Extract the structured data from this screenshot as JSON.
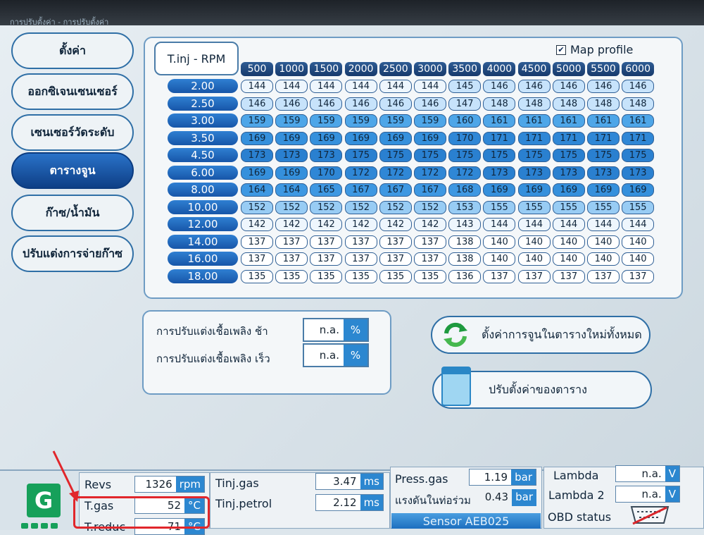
{
  "window": {
    "title": "การปรับตั้งค่า - การปรับตั้งค่า"
  },
  "menu": {
    "items": [
      {
        "label": "ตั้งค่า",
        "active": false
      },
      {
        "label": "ออกซิเจนเซนเซอร์",
        "active": false
      },
      {
        "label": "เซนเซอร์วัดระดับ",
        "active": false
      },
      {
        "label": "ตารางจูน",
        "active": true
      },
      {
        "label": "ก๊าซ/น้ำมัน",
        "active": false
      },
      {
        "label": "ปรับแต่งการจ่ายก๊าซ",
        "active": false
      }
    ]
  },
  "map": {
    "axis_label": "T.inj - RPM",
    "map_profile": {
      "label": "Map profile",
      "checked": true
    },
    "rpm": [
      "500",
      "1000",
      "1500",
      "2000",
      "2500",
      "3000",
      "3500",
      "4000",
      "4500",
      "5000",
      "5500",
      "6000"
    ],
    "tinj": [
      "2.00",
      "2.50",
      "3.00",
      "3.50",
      "4.50",
      "6.00",
      "8.00",
      "10.00",
      "12.00",
      "14.00",
      "16.00",
      "18.00"
    ],
    "rows": [
      [
        "144",
        "144",
        "144",
        "144",
        "144",
        "144",
        "145",
        "146",
        "146",
        "146",
        "146",
        "146"
      ],
      [
        "146",
        "146",
        "146",
        "146",
        "146",
        "146",
        "147",
        "148",
        "148",
        "148",
        "148",
        "148"
      ],
      [
        "159",
        "159",
        "159",
        "159",
        "159",
        "159",
        "160",
        "161",
        "161",
        "161",
        "161",
        "161"
      ],
      [
        "169",
        "169",
        "169",
        "169",
        "169",
        "169",
        "170",
        "171",
        "171",
        "171",
        "171",
        "171"
      ],
      [
        "173",
        "173",
        "173",
        "175",
        "175",
        "175",
        "175",
        "175",
        "175",
        "175",
        "175",
        "175"
      ],
      [
        "169",
        "169",
        "170",
        "172",
        "172",
        "172",
        "172",
        "173",
        "173",
        "173",
        "173",
        "173"
      ],
      [
        "164",
        "164",
        "165",
        "167",
        "167",
        "167",
        "168",
        "169",
        "169",
        "169",
        "169",
        "169"
      ],
      [
        "152",
        "152",
        "152",
        "152",
        "152",
        "152",
        "153",
        "155",
        "155",
        "155",
        "155",
        "155"
      ],
      [
        "142",
        "142",
        "142",
        "142",
        "142",
        "142",
        "143",
        "144",
        "144",
        "144",
        "144",
        "144"
      ],
      [
        "137",
        "137",
        "137",
        "137",
        "137",
        "137",
        "138",
        "140",
        "140",
        "140",
        "140",
        "140"
      ],
      [
        "137",
        "137",
        "137",
        "137",
        "137",
        "137",
        "138",
        "140",
        "140",
        "140",
        "140",
        "140"
      ],
      [
        "135",
        "135",
        "135",
        "135",
        "135",
        "135",
        "136",
        "137",
        "137",
        "137",
        "137",
        "137"
      ]
    ],
    "shades": {
      "135": "#ffffff",
      "136": "#ffffff",
      "137": "#ffffff",
      "138": "#ffffff",
      "140": "#ffffff",
      "142": "#eef6fd",
      "143": "#eef6fd",
      "144": "#eef6fd",
      "145": "#c7e3fb",
      "146": "#c7e3fb",
      "147": "#c7e3fb",
      "148": "#c7e3fb",
      "152": "#98ccf4",
      "153": "#98ccf4",
      "155": "#98ccf4",
      "159": "#4ea6e8",
      "160": "#4ea6e8",
      "161": "#4ea6e8",
      "164": "#3e98e2",
      "165": "#3e98e2",
      "167": "#3e98e2",
      "168": "#3e98e2",
      "169": "#3590dc",
      "170": "#2f87d6",
      "171": "#2f87d6",
      "172": "#2f87d6",
      "173": "#2a80d0",
      "175": "#2a80d0"
    }
  },
  "fuel": {
    "slow_label": "การปรับแต่งเชื้อเพลิง ช้า",
    "fast_label": "การปรับแต่งเชื้อเพลิง เร็ว",
    "slow_value": "n.a.",
    "fast_value": "n.a.",
    "unit": "%"
  },
  "actions": {
    "reset_label": "ตั้งค่าการจูนในตารางใหม่ทั้งหมด",
    "adjust_label": "ปรับตั้งค่าของตาราง"
  },
  "status": {
    "logo_letter": "G",
    "revs": {
      "label": "Revs",
      "value": "1326",
      "unit": "rpm"
    },
    "tgas": {
      "label": "T.gas",
      "value": "52",
      "unit": "°C"
    },
    "treduc": {
      "label": "T.reduc",
      "value": "71",
      "unit": "°C"
    },
    "tinj_gas": {
      "label": "Tinj.gas",
      "value": "3.47",
      "unit": "ms"
    },
    "tinj_petrol": {
      "label": "Tinj.petrol",
      "value": "2.12",
      "unit": "ms"
    },
    "press_gas": {
      "label": "Press.gas",
      "value": "1.19",
      "unit": "bar"
    },
    "manifold": {
      "label": "แรงดันในท่อร่วม",
      "value": "0.43",
      "unit": "bar"
    },
    "sensor_button": "Sensor AEB025",
    "lambda": {
      "label": "Lambda",
      "value": "n.a.",
      "unit": "V"
    },
    "lambda2": {
      "label": "Lambda 2",
      "value": "n.a.",
      "unit": "V"
    },
    "obd": {
      "label": "OBD status"
    }
  },
  "colors": {
    "accent": "#2c87d0",
    "highlight": "#e1262b",
    "logo": "#16a05a"
  }
}
